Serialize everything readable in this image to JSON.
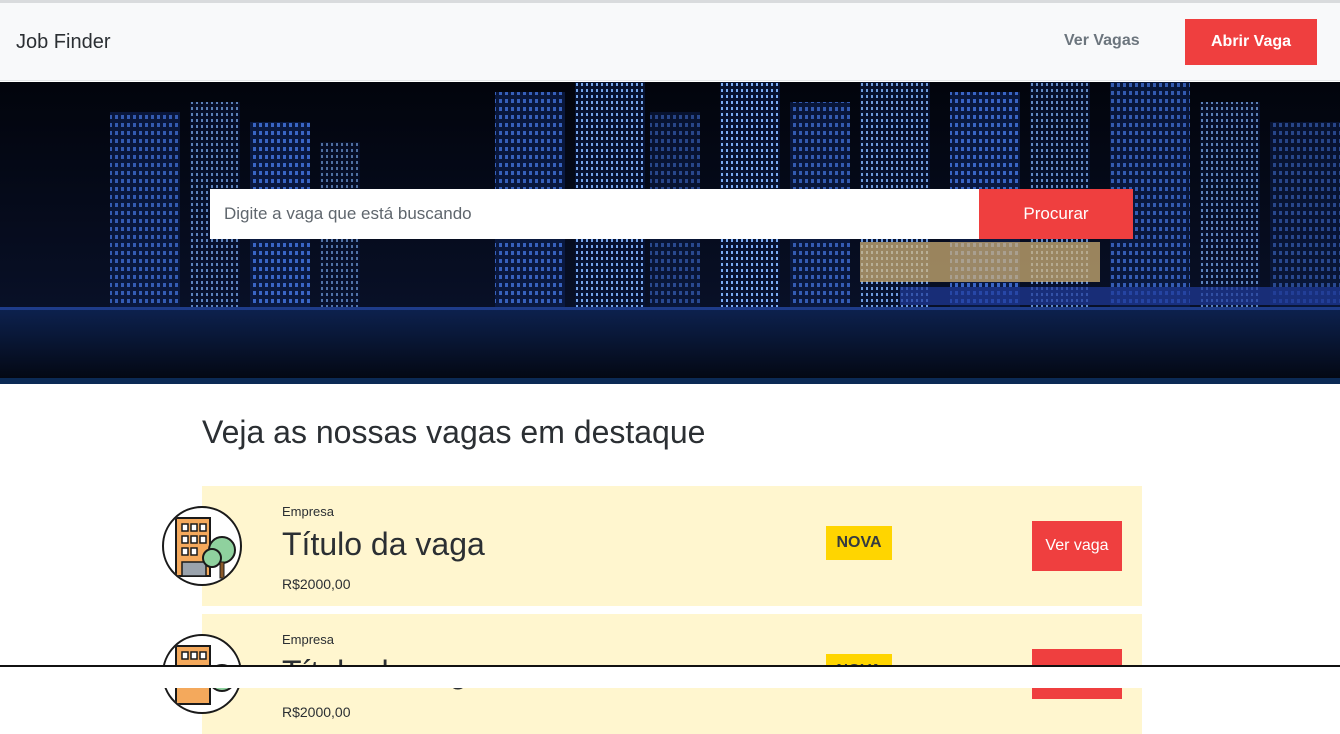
{
  "navbar": {
    "brand": "Job Finder",
    "link_label": "Ver Vagas",
    "cta_label": "Abrir Vaga"
  },
  "search": {
    "placeholder": "Digite a vaga que está buscando",
    "button_label": "Procurar"
  },
  "featured": {
    "title": "Veja as nossas vagas em destaque",
    "jobs": [
      {
        "company": "Empresa",
        "title": "Título da vaga",
        "salary": "R$2000,00",
        "badge": "NOVA",
        "button_label": "Ver vaga"
      },
      {
        "company": "Empresa",
        "title": "Título da vaga",
        "salary": "R$2000,00",
        "badge": "NOVA",
        "button_label": "Ver vaga"
      }
    ]
  },
  "colors": {
    "accent": "#ef3f3f",
    "badge": "#ffd500",
    "card_bg": "#fff6cf",
    "navbar_bg": "#f8f9fa"
  },
  "icons": {
    "company_logo": "building-with-trees-icon"
  }
}
